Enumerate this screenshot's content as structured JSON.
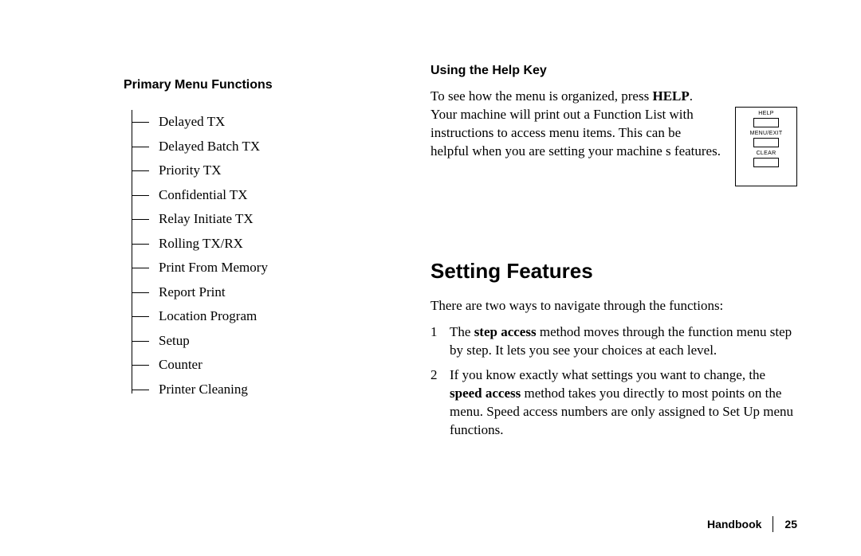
{
  "left": {
    "heading": "Primary Menu Functions",
    "items": [
      "Delayed TX",
      "Delayed Batch TX",
      "Priority TX",
      "Confidential TX",
      "Relay Initiate TX",
      "Rolling TX/RX",
      "Print From Memory",
      "Report Print",
      "Location Program",
      "Setup",
      "Counter",
      "Printer Cleaning"
    ]
  },
  "help": {
    "heading": "Using the Help Key",
    "para_pre": "To see how the menu is organized, press ",
    "para_bold": "HELP",
    "para_post": ". Your machine will print out a Function List with instructions to access menu items. This can be helpful when you are setting your machine s features.",
    "keys": {
      "k1": "HELP",
      "k2": "MENU/EXIT",
      "k3": "CLEAR"
    }
  },
  "setting": {
    "heading": "Setting Features",
    "intro": "There are two ways to navigate through the functions:",
    "items": [
      {
        "num": "1",
        "pre": "The ",
        "bold": "step access",
        "post": " method moves through the function menu step by step. It lets you see your choices at each level."
      },
      {
        "num": "2",
        "pre": "If you know exactly what settings you want to change, the ",
        "bold": "speed access",
        "post": " method takes you directly to most points on the menu. Speed access numbers are only assigned to Set Up menu functions."
      }
    ]
  },
  "footer": {
    "label": "Handbook",
    "page": "25"
  }
}
